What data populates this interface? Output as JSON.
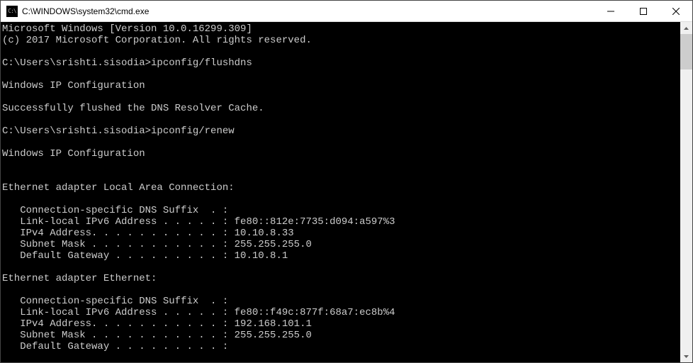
{
  "titlebar": {
    "icon_text": "C:\\",
    "title": "C:\\WINDOWS\\system32\\cmd.exe"
  },
  "terminal": {
    "lines": [
      "Microsoft Windows [Version 10.0.16299.309]",
      "(c) 2017 Microsoft Corporation. All rights reserved.",
      "",
      "C:\\Users\\srishti.sisodia>ipconfig/flushdns",
      "",
      "Windows IP Configuration",
      "",
      "Successfully flushed the DNS Resolver Cache.",
      "",
      "C:\\Users\\srishti.sisodia>ipconfig/renew",
      "",
      "Windows IP Configuration",
      "",
      "",
      "Ethernet adapter Local Area Connection:",
      "",
      "   Connection-specific DNS Suffix  . :",
      "   Link-local IPv6 Address . . . . . : fe80::812e:7735:d094:a597%3",
      "   IPv4 Address. . . . . . . . . . . : 10.10.8.33",
      "   Subnet Mask . . . . . . . . . . . : 255.255.255.0",
      "   Default Gateway . . . . . . . . . : 10.10.8.1",
      "",
      "Ethernet adapter Ethernet:",
      "",
      "   Connection-specific DNS Suffix  . :",
      "   Link-local IPv6 Address . . . . . : fe80::f49c:877f:68a7:ec8b%4",
      "   IPv4 Address. . . . . . . . . . . : 192.168.101.1",
      "   Subnet Mask . . . . . . . . . . . : 255.255.255.0",
      "   Default Gateway . . . . . . . . . :"
    ]
  }
}
